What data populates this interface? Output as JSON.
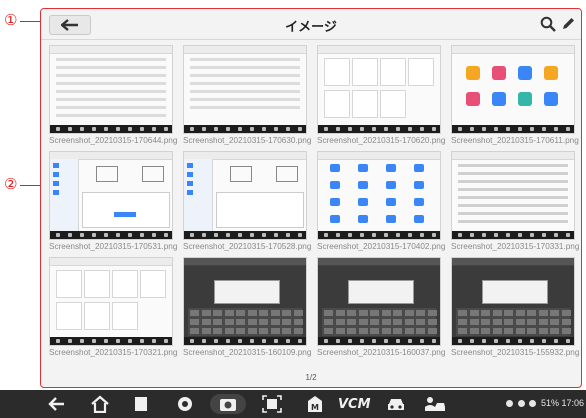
{
  "callouts": {
    "one": "①",
    "two": "②"
  },
  "header": {
    "title": "イメージ",
    "back_icon": "arrow-left-icon",
    "search_icon": "search-icon",
    "edit_icon": "pencil-icon"
  },
  "images": [
    {
      "name": "Screenshot_20210315-170644.png",
      "kind": "form"
    },
    {
      "name": "Screenshot_20210315-170630.png",
      "kind": "list"
    },
    {
      "name": "Screenshot_20210315-170620.png",
      "kind": "cards"
    },
    {
      "name": "Screenshot_20210315-170611.png",
      "kind": "apps"
    },
    {
      "name": "Screenshot_20210315-170531.png",
      "kind": "sidebar-dialog"
    },
    {
      "name": "Screenshot_20210315-170528.png",
      "kind": "sidebar-dialog2"
    },
    {
      "name": "Screenshot_20210315-170402.png",
      "kind": "icon-grid"
    },
    {
      "name": "Screenshot_20210315-170331.png",
      "kind": "table"
    },
    {
      "name": "Screenshot_20210315-170321.png",
      "kind": "cards"
    },
    {
      "name": "Screenshot_20210315-160109.png",
      "kind": "keyboard-dark"
    },
    {
      "name": "Screenshot_20210315-160037.png",
      "kind": "keyboard-dark2"
    },
    {
      "name": "Screenshot_20210315-155932.png",
      "kind": "keyboard-dark3"
    }
  ],
  "pagination": {
    "label": "1/2"
  },
  "system_bar": {
    "icons": [
      "back-icon",
      "home-icon",
      "recent-apps-icon",
      "browser-icon",
      "camera-icon",
      "screen-capture-icon",
      "shop-icon",
      "vcm-icon",
      "car-icon",
      "user-car-icon"
    ],
    "vcm_label": "VCM",
    "status": "51% 17:06"
  },
  "colors": {
    "accent_red": "#e02020",
    "navbar": "#2b2b2b",
    "frame_bg": "#f3f3f3"
  }
}
